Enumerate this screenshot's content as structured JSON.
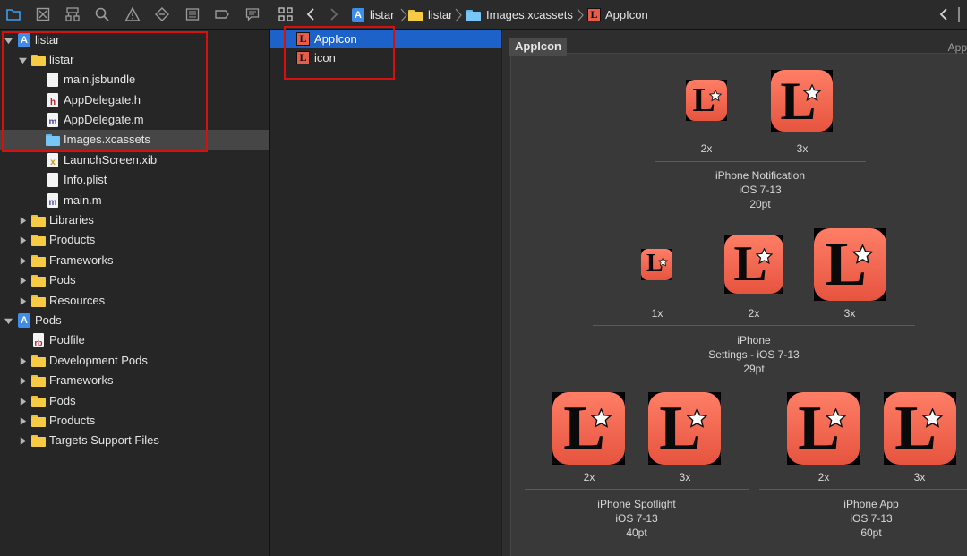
{
  "navigator": {
    "toolbar_icons": [
      "folder-icon",
      "source-control-icon",
      "hierarchy-icon",
      "search-icon",
      "warning-icon",
      "test-icon",
      "debug-icon",
      "breakpoint-icon",
      "report-icon"
    ],
    "items": [
      {
        "label": "listar",
        "icon": "project-icon",
        "depth": 0,
        "expanded": true
      },
      {
        "label": "listar",
        "icon": "folder-icon",
        "depth": 1,
        "expanded": true
      },
      {
        "label": "main.jsbundle",
        "icon": "document-icon",
        "depth": 2
      },
      {
        "label": "AppDelegate.h",
        "icon": "header-file-icon",
        "glyph": "h",
        "depth": 2
      },
      {
        "label": "AppDelegate.m",
        "icon": "objc-file-icon",
        "glyph": "m",
        "depth": 2
      },
      {
        "label": "Images.xcassets",
        "icon": "asset-catalog-icon",
        "depth": 2,
        "selected": true
      },
      {
        "label": "LaunchScreen.xib",
        "icon": "xib-file-icon",
        "glyph": "x",
        "depth": 2
      },
      {
        "label": "Info.plist",
        "icon": "plist-file-icon",
        "depth": 2
      },
      {
        "label": "main.m",
        "icon": "objc-file-icon",
        "glyph": "m",
        "depth": 2
      },
      {
        "label": "Libraries",
        "icon": "folder-icon",
        "depth": 1,
        "expanded": false
      },
      {
        "label": "Products",
        "icon": "folder-icon",
        "depth": 1,
        "expanded": false
      },
      {
        "label": "Frameworks",
        "icon": "folder-icon",
        "depth": 1,
        "expanded": false
      },
      {
        "label": "Pods",
        "icon": "folder-icon",
        "depth": 1,
        "expanded": false
      },
      {
        "label": "Resources",
        "icon": "folder-icon",
        "depth": 1,
        "expanded": false
      },
      {
        "label": "Pods",
        "icon": "project-icon",
        "depth": 0,
        "expanded": true
      },
      {
        "label": "Podfile",
        "icon": "ruby-file-icon",
        "glyph": "rb",
        "depth": 1
      },
      {
        "label": "Development Pods",
        "icon": "folder-icon",
        "depth": 1,
        "expanded": false
      },
      {
        "label": "Frameworks",
        "icon": "folder-icon",
        "depth": 1,
        "expanded": false
      },
      {
        "label": "Pods",
        "icon": "folder-icon",
        "depth": 1,
        "expanded": false
      },
      {
        "label": "Products",
        "icon": "folder-icon",
        "depth": 1,
        "expanded": false
      },
      {
        "label": "Targets Support Files",
        "icon": "folder-icon",
        "depth": 1,
        "expanded": false
      }
    ]
  },
  "jumpbar": {
    "crumbs": [
      "listar",
      "listar",
      "Images.xcassets",
      "AppIcon"
    ]
  },
  "asset_list": {
    "items": [
      {
        "label": "AppIcon",
        "selected": true
      },
      {
        "label": "icon",
        "selected": false
      }
    ]
  },
  "editor": {
    "set_title": "AppIcon",
    "set_type": "App",
    "icon_glyph": "L",
    "groups": [
      {
        "scales": [
          "2x",
          "3x"
        ],
        "caption": [
          "iPhone Notification",
          "iOS 7-13",
          "20pt"
        ]
      },
      {
        "scales": [
          "1x",
          "2x",
          "3x"
        ],
        "caption": [
          "iPhone",
          "Settings - iOS 7-13",
          "29pt"
        ]
      },
      {
        "scales": [
          "2x",
          "3x"
        ],
        "caption": [
          "iPhone Spotlight",
          "iOS 7-13",
          "40pt"
        ]
      },
      {
        "scales": [
          "2x",
          "3x"
        ],
        "caption": [
          "iPhone App",
          "iOS 7-13",
          "60pt"
        ]
      }
    ]
  },
  "colors": {
    "selection_blue": "#1d62c9",
    "annotation_red": "#d80f0f",
    "icon_orange": "#f06a53",
    "folder_yellow": "#f8cb45"
  }
}
